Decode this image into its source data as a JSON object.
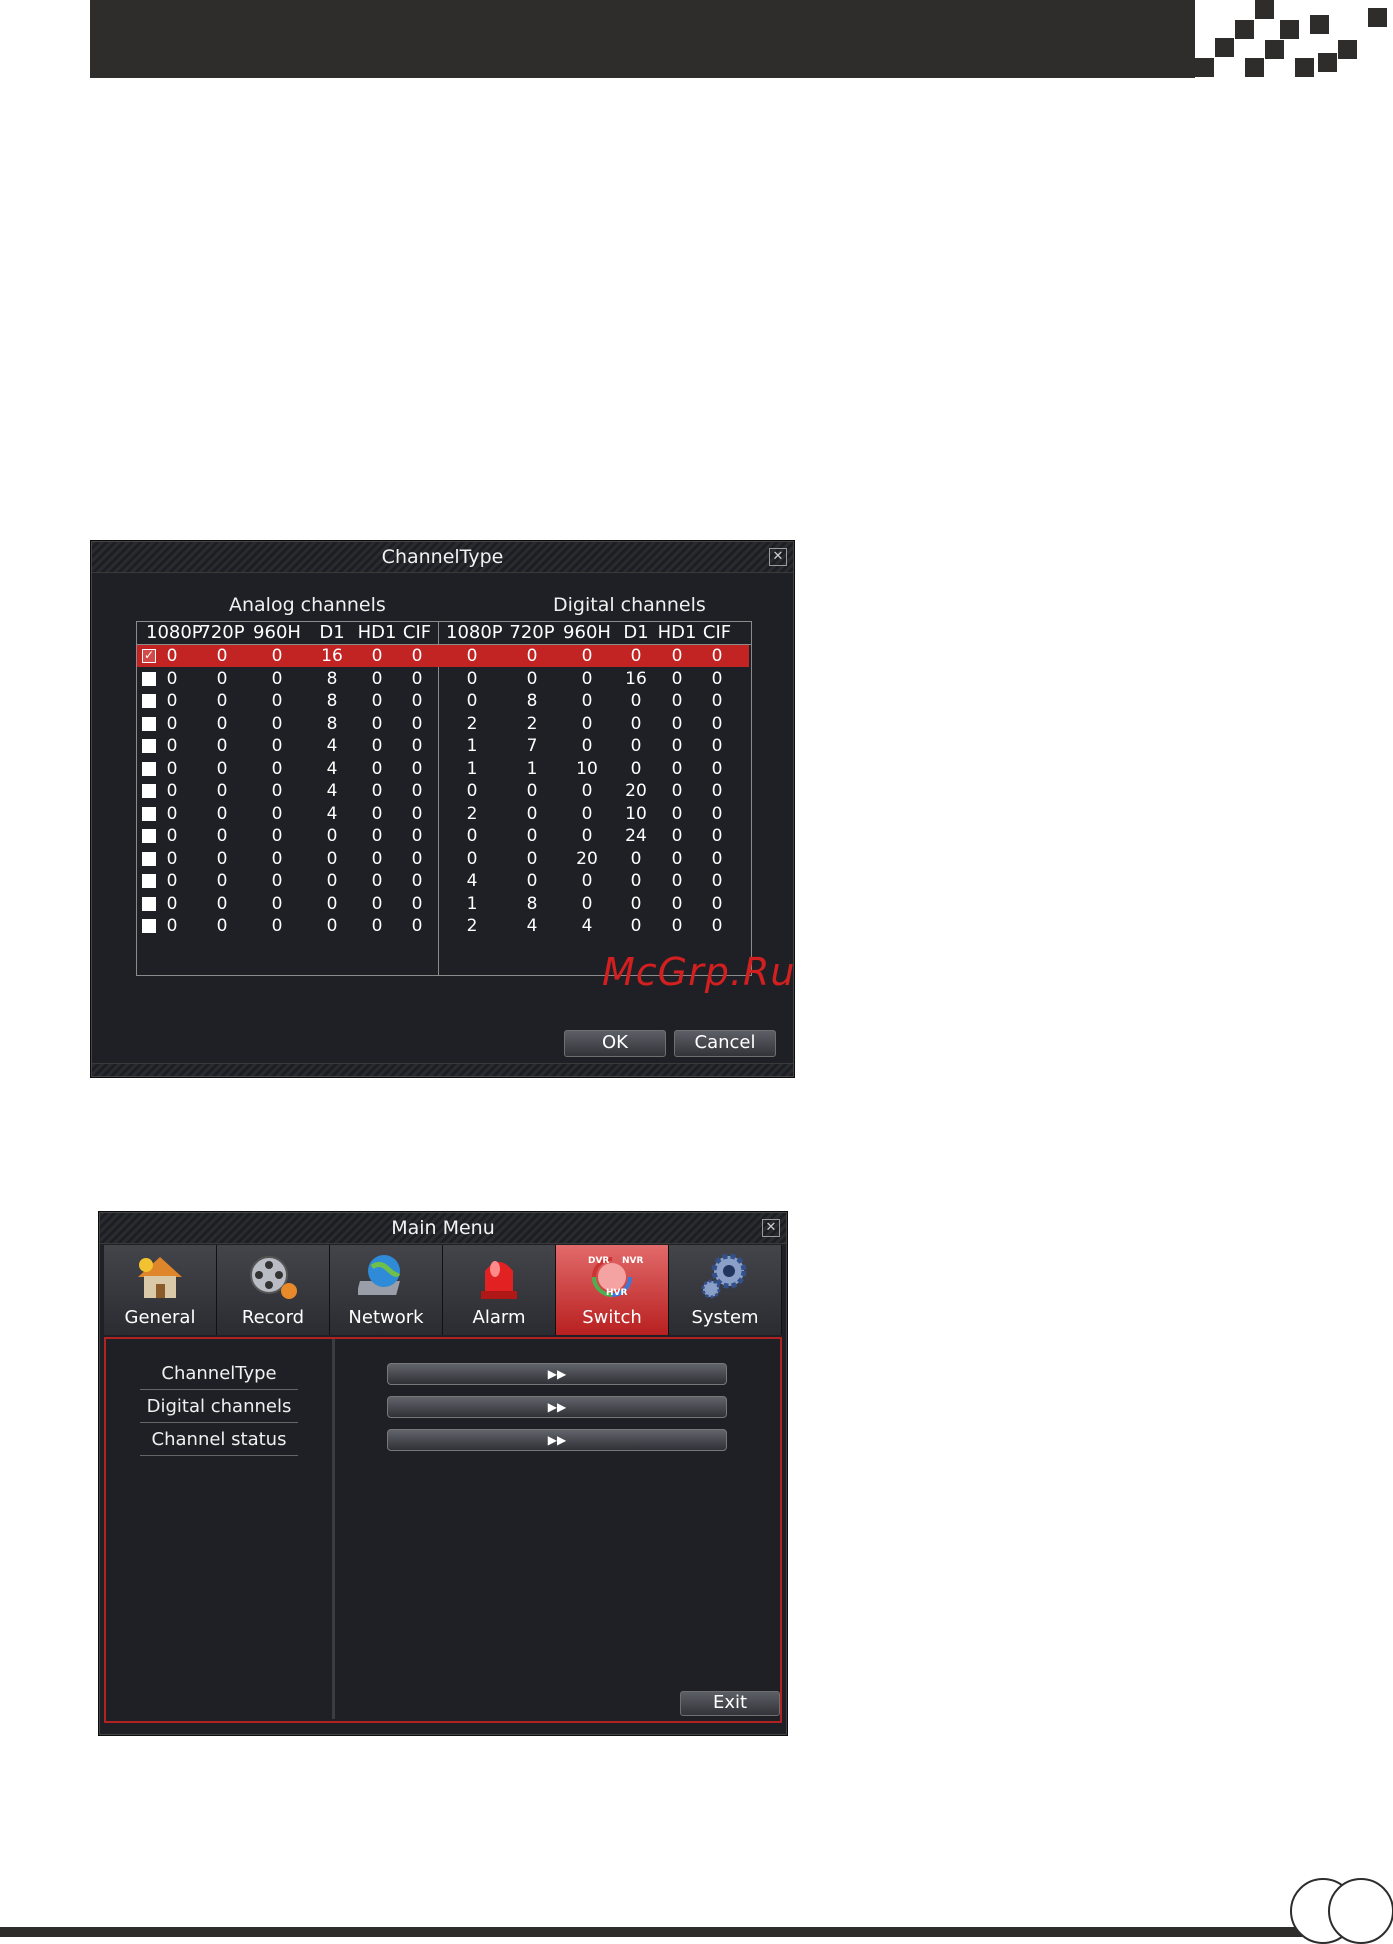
{
  "channel_type_window": {
    "title": "ChannelType",
    "analog_title": "Analog channels",
    "digital_title": "Digital channels",
    "analog_headers": [
      "1080P",
      "720P",
      "960H",
      "D1",
      "HD1",
      "CIF"
    ],
    "digital_headers": [
      "1080P",
      "720P",
      "960H",
      "D1",
      "HD1",
      "CIF"
    ],
    "selected_row": 0,
    "rows": [
      {
        "analog": [
          "0",
          "0",
          "0",
          "16",
          "0",
          "0"
        ],
        "digital": [
          "0",
          "0",
          "0",
          "0",
          "0",
          "0"
        ]
      },
      {
        "analog": [
          "0",
          "0",
          "0",
          "8",
          "0",
          "0"
        ],
        "digital": [
          "0",
          "0",
          "0",
          "16",
          "0",
          "0"
        ]
      },
      {
        "analog": [
          "0",
          "0",
          "0",
          "8",
          "0",
          "0"
        ],
        "digital": [
          "0",
          "8",
          "0",
          "0",
          "0",
          "0"
        ]
      },
      {
        "analog": [
          "0",
          "0",
          "0",
          "8",
          "0",
          "0"
        ],
        "digital": [
          "2",
          "2",
          "0",
          "0",
          "0",
          "0"
        ]
      },
      {
        "analog": [
          "0",
          "0",
          "0",
          "4",
          "0",
          "0"
        ],
        "digital": [
          "1",
          "7",
          "0",
          "0",
          "0",
          "0"
        ]
      },
      {
        "analog": [
          "0",
          "0",
          "0",
          "4",
          "0",
          "0"
        ],
        "digital": [
          "1",
          "1",
          "10",
          "0",
          "0",
          "0"
        ]
      },
      {
        "analog": [
          "0",
          "0",
          "0",
          "4",
          "0",
          "0"
        ],
        "digital": [
          "0",
          "0",
          "0",
          "20",
          "0",
          "0"
        ]
      },
      {
        "analog": [
          "0",
          "0",
          "0",
          "4",
          "0",
          "0"
        ],
        "digital": [
          "2",
          "0",
          "0",
          "10",
          "0",
          "0"
        ]
      },
      {
        "analog": [
          "0",
          "0",
          "0",
          "0",
          "0",
          "0"
        ],
        "digital": [
          "0",
          "0",
          "0",
          "24",
          "0",
          "0"
        ]
      },
      {
        "analog": [
          "0",
          "0",
          "0",
          "0",
          "0",
          "0"
        ],
        "digital": [
          "0",
          "0",
          "20",
          "0",
          "0",
          "0"
        ]
      },
      {
        "analog": [
          "0",
          "0",
          "0",
          "0",
          "0",
          "0"
        ],
        "digital": [
          "4",
          "0",
          "0",
          "0",
          "0",
          "0"
        ]
      },
      {
        "analog": [
          "0",
          "0",
          "0",
          "0",
          "0",
          "0"
        ],
        "digital": [
          "1",
          "8",
          "0",
          "0",
          "0",
          "0"
        ]
      },
      {
        "analog": [
          "0",
          "0",
          "0",
          "0",
          "0",
          "0"
        ],
        "digital": [
          "2",
          "4",
          "4",
          "0",
          "0",
          "0"
        ]
      }
    ],
    "ok_label": "OK",
    "cancel_label": "Cancel"
  },
  "main_menu_window": {
    "title": "Main Menu",
    "tabs": [
      {
        "label": "General",
        "icon": "house-icon"
      },
      {
        "label": "Record",
        "icon": "film-reel-icon"
      },
      {
        "label": "Network",
        "icon": "globe-laptop-icon"
      },
      {
        "label": "Alarm",
        "icon": "siren-icon"
      },
      {
        "label": "Switch",
        "icon": "dvr-nvr-hvr-switch-icon",
        "active": true,
        "icon_text": [
          "DVR",
          "NVR",
          "HVR"
        ]
      },
      {
        "label": "System",
        "icon": "gears-icon"
      }
    ],
    "side_items": [
      "ChannelType",
      "Digital channels",
      "Channel status"
    ],
    "arrow_glyph": "▶▶",
    "exit_label": "Exit"
  },
  "watermark": "McGrp.Ru",
  "colors": {
    "accent": "#c22424",
    "window_bg": "#1f2026",
    "page_dark": "#2e2d2c"
  }
}
